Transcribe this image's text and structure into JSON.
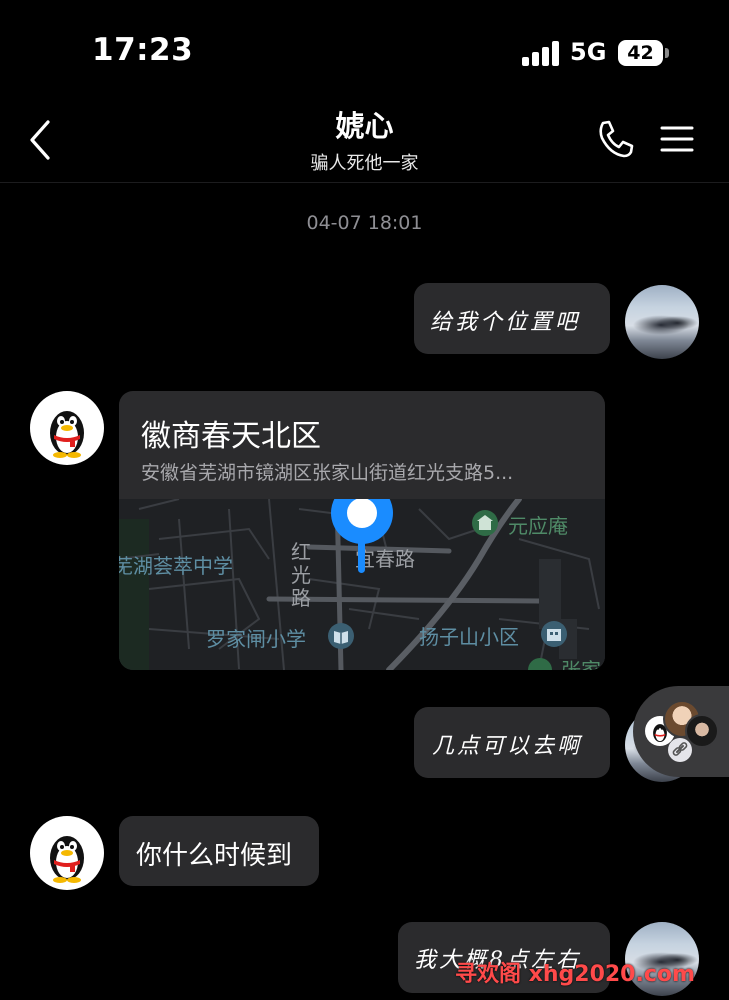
{
  "status_bar": {
    "time": "17:23",
    "network": "5G",
    "battery": "42"
  },
  "header": {
    "title": "婋心",
    "subtitle": "骗人死他一家",
    "back_icon": "chevron-left-icon",
    "call_icon": "phone-icon",
    "menu_icon": "hamburger-menu-icon"
  },
  "timestamp": "04-07 18:01",
  "messages": [
    {
      "sender": "self",
      "type": "text",
      "text": "给我个位置吧"
    },
    {
      "sender": "contact",
      "type": "location",
      "name": "徽商春天北区",
      "address": "安徽省芜湖市镜湖区张家山街道红光支路5...",
      "map_labels": [
        "元应庵",
        "芜湖荟萃中学",
        "红光路",
        "宜春路",
        "罗家闸小学",
        "扬子山小区",
        "张家"
      ]
    },
    {
      "sender": "self",
      "type": "text",
      "text": "几点可以去啊"
    },
    {
      "sender": "contact",
      "type": "text",
      "text": "你什么时候到"
    },
    {
      "sender": "self",
      "type": "text",
      "text": "我大概8点左右"
    }
  ],
  "watermark": "寻欢阁 xhg2020.com",
  "colors": {
    "background": "#000000",
    "bubble": "#2b2b2d",
    "pin": "#1a8cff",
    "watermark": "#ff4a4a"
  }
}
